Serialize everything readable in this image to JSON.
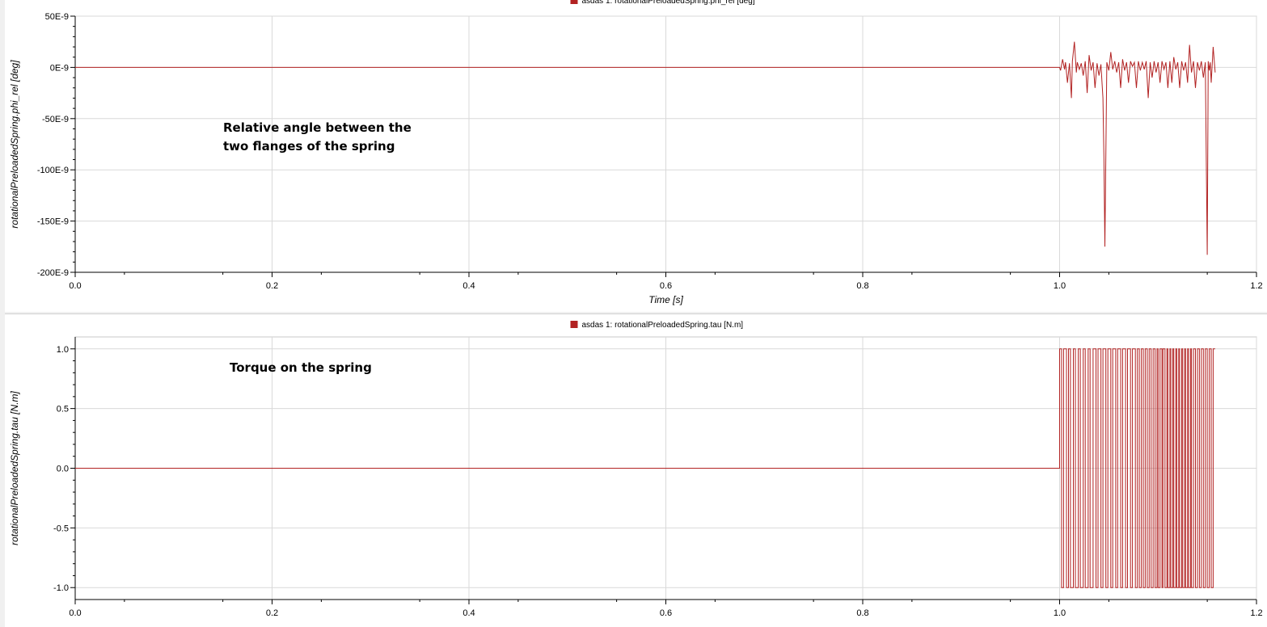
{
  "colors": {
    "series": "#b22222",
    "grid": "#d9d9d9",
    "axis": "#000000",
    "background": "#ffffff"
  },
  "chart_data": [
    {
      "type": "line",
      "legend": "asdas 1: rotationalPreloadedSpring.phi_rel [deg]",
      "legend_placement": "top-center",
      "xlabel": "Time [s]",
      "ylabel": "rotationalPreloadedSpring.phi_rel [deg]",
      "xlim": [
        0,
        1.2
      ],
      "ylim": [
        -2e-07,
        5e-08
      ],
      "grid": true,
      "x_ticks": [
        {
          "value": 0.0,
          "label": "0.0"
        },
        {
          "value": 0.2,
          "label": "0.2"
        },
        {
          "value": 0.4,
          "label": "0.4"
        },
        {
          "value": 0.6,
          "label": "0.6"
        },
        {
          "value": 0.8,
          "label": "0.8"
        },
        {
          "value": 1.0,
          "label": "1.0"
        },
        {
          "value": 1.2,
          "label": "1.2"
        }
      ],
      "y_ticks": [
        {
          "value": 5e-08,
          "label": "50E-9"
        },
        {
          "value": 0,
          "label": "0E-9"
        },
        {
          "value": -5e-08,
          "label": "-50E-9"
        },
        {
          "value": -1e-07,
          "label": "-100E-9"
        },
        {
          "value": -1.5e-07,
          "label": "-150E-9"
        },
        {
          "value": -2e-07,
          "label": "-200E-9"
        }
      ],
      "annotation": "Relative angle between the\ntwo flanges of the spring",
      "series": [
        {
          "x": [
            0,
            1.0,
            1.001,
            1.003,
            1.005,
            1.006,
            1.008,
            1.01,
            1.012,
            1.013,
            1.015,
            1.017,
            1.018,
            1.02,
            1.022,
            1.024,
            1.026,
            1.028,
            1.03,
            1.032,
            1.034,
            1.036,
            1.038,
            1.04,
            1.042,
            1.044,
            1.045,
            1.046,
            1.048,
            1.05,
            1.052,
            1.054,
            1.056,
            1.058,
            1.06,
            1.062,
            1.064,
            1.066,
            1.068,
            1.07,
            1.072,
            1.074,
            1.076,
            1.078,
            1.08,
            1.082,
            1.084,
            1.086,
            1.088,
            1.09,
            1.092,
            1.094,
            1.096,
            1.098,
            1.1,
            1.102,
            1.104,
            1.106,
            1.108,
            1.11,
            1.112,
            1.114,
            1.116,
            1.118,
            1.12,
            1.122,
            1.124,
            1.126,
            1.128,
            1.13,
            1.132,
            1.134,
            1.136,
            1.138,
            1.14,
            1.142,
            1.144,
            1.146,
            1.148,
            1.15,
            1.151,
            1.152,
            1.153,
            1.154,
            1.156,
            1.158
          ],
          "y": [
            0,
            0,
            -3e-09,
            8e-09,
            -2e-09,
            5e-09,
            -1.5e-08,
            4e-09,
            -3e-08,
            6e-09,
            2.5e-08,
            -5e-09,
            5e-09,
            -2e-09,
            4e-09,
            -8e-09,
            6e-09,
            -2.5e-08,
            1.2e-08,
            -3e-09,
            5e-09,
            -2e-08,
            4e-09,
            -8e-09,
            3e-09,
            -3e-08,
            -8.8e-08,
            -1.75e-07,
            5e-09,
            -3e-09,
            1.5e-08,
            -2e-09,
            6e-09,
            -5e-09,
            5e-09,
            -2e-08,
            8e-09,
            -3e-09,
            5e-09,
            -1.5e-08,
            6e-09,
            1e-09,
            5e-09,
            -2e-08,
            6e-09,
            -3e-09,
            5e-09,
            -2e-09,
            6e-09,
            -3e-08,
            5e-09,
            -1e-08,
            6e-09,
            -5e-09,
            5e-09,
            -1.5e-08,
            6e-09,
            -2e-09,
            5e-09,
            -2e-08,
            6e-09,
            -1.5e-08,
            1e-08,
            -2e-09,
            5e-09,
            -2e-08,
            6e-09,
            -3e-09,
            5e-09,
            -1.5e-08,
            2.2e-08,
            -5e-09,
            6e-09,
            -2e-08,
            5e-09,
            -3e-09,
            6e-09,
            -1e-08,
            5e-09,
            -1.83e-07,
            6e-09,
            -3e-09,
            5e-09,
            -1.5e-08,
            2e-08,
            -5e-09
          ]
        }
      ]
    },
    {
      "type": "line",
      "legend": "asdas 1: rotationalPreloadedSpring.tau [N.m]",
      "legend_placement": "top-center",
      "xlabel": "",
      "ylabel": "rotationalPreloadedSpring.tau [N.m]",
      "xlim": [
        0,
        1.2
      ],
      "ylim": [
        -1.1,
        1.1
      ],
      "grid": true,
      "x_ticks": [
        {
          "value": 0.0,
          "label": "0.0"
        },
        {
          "value": 0.2,
          "label": "0.2"
        },
        {
          "value": 0.4,
          "label": "0.4"
        },
        {
          "value": 0.6,
          "label": "0.6"
        },
        {
          "value": 0.8,
          "label": "0.8"
        },
        {
          "value": 1.0,
          "label": "1.0"
        },
        {
          "value": 1.2,
          "label": "1.2"
        }
      ],
      "y_ticks": [
        {
          "value": 1.0,
          "label": "1.0"
        },
        {
          "value": 0.5,
          "label": "0.5"
        },
        {
          "value": 0.0,
          "label": "0.0"
        },
        {
          "value": -0.5,
          "label": "-0.5"
        },
        {
          "value": -1.0,
          "label": "-1.0"
        }
      ],
      "annotation": "Torque on the spring",
      "series": [
        {
          "type": "step",
          "start": 0,
          "end": 1.158,
          "initial_value": 0,
          "switch_times": [
            1.0,
            1.002,
            1.004,
            1.007,
            1.009,
            1.011,
            1.014,
            1.016,
            1.019,
            1.021,
            1.024,
            1.026,
            1.029,
            1.031,
            1.034,
            1.037,
            1.039,
            1.042,
            1.044,
            1.047,
            1.049,
            1.052,
            1.054,
            1.057,
            1.059,
            1.062,
            1.064,
            1.067,
            1.069,
            1.072,
            1.074,
            1.077,
            1.079,
            1.081,
            1.083,
            1.085,
            1.087,
            1.089,
            1.091,
            1.093,
            1.095,
            1.097,
            1.099,
            1.1,
            1.102,
            1.104,
            1.105,
            1.107,
            1.109,
            1.11,
            1.112,
            1.113,
            1.115,
            1.116,
            1.118,
            1.119,
            1.121,
            1.122,
            1.124,
            1.125,
            1.127,
            1.128,
            1.13,
            1.131,
            1.133,
            1.134,
            1.136,
            1.138,
            1.14,
            1.142,
            1.144,
            1.146,
            1.148,
            1.15,
            1.152,
            1.154,
            1.156
          ],
          "levels": [
            -1,
            1
          ]
        }
      ]
    }
  ]
}
